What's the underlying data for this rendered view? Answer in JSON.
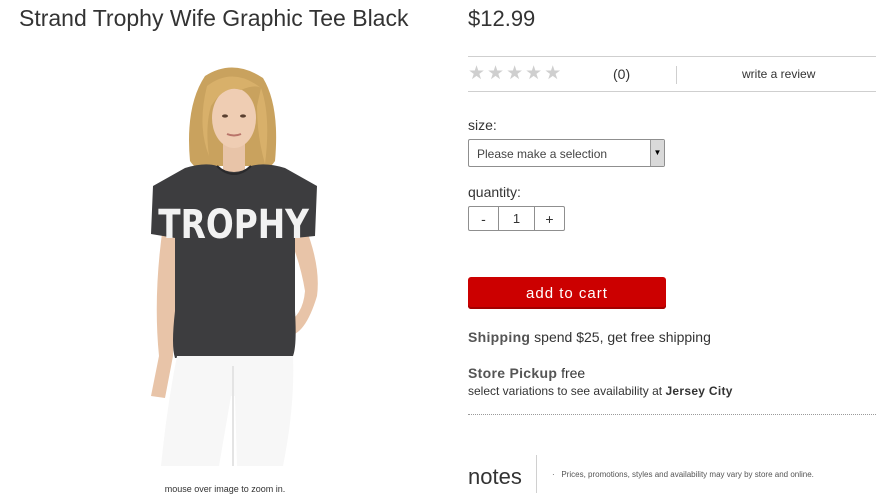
{
  "product": {
    "title": "Strand Trophy Wife Graphic Tee Black",
    "price": "$12.99",
    "image_alt": "model wearing black tee",
    "shirt_text": "TROPHY",
    "zoom_hint": "mouse over image to zoom in."
  },
  "rating": {
    "stars_filled": 0,
    "stars_total": 5,
    "count": "(0)",
    "write_review": "write a review"
  },
  "size": {
    "label": "size:",
    "selected": "Please make a selection"
  },
  "quantity": {
    "label": "quantity:",
    "minus": "-",
    "value": "1",
    "plus": "+"
  },
  "add_to_cart": "add to cart",
  "shipping": {
    "label": "Shipping",
    "text": " spend $25, get free shipping"
  },
  "pickup": {
    "label": "Store Pickup",
    "text": " free",
    "sub_text": "select variations to see availability at ",
    "store": "Jersey City"
  },
  "notes": {
    "heading": "notes",
    "bullet": "·",
    "text": "Prices, promotions, styles and availability may vary by store and online."
  },
  "colors": {
    "accent": "#cc0000",
    "star_empty": "#cfcfcf",
    "text": "#333333"
  }
}
